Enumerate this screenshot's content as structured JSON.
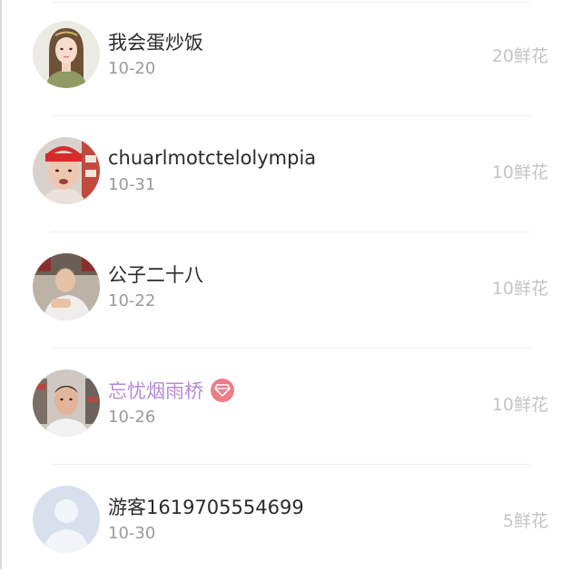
{
  "donors": [
    {
      "name": "我会蛋炒饭",
      "date": "10-20",
      "flowers": "20鲜花",
      "vip": false,
      "avatar_icon": "girl-illustration-avatar"
    },
    {
      "name": "chuarlmotctelolympia",
      "date": "10-31",
      "flowers": "10鲜花",
      "vip": false,
      "avatar_icon": "red-headband-portrait-avatar"
    },
    {
      "name": "公子二十八",
      "date": "10-22",
      "flowers": "10鲜花",
      "vip": false,
      "avatar_icon": "man-sitting-photo-avatar"
    },
    {
      "name": "忘忧烟雨桥",
      "date": "10-26",
      "flowers": "10鲜花",
      "vip": true,
      "avatar_icon": "man-shop-photo-avatar"
    },
    {
      "name": "游客1619705554699",
      "date": "10-30",
      "flowers": "5鲜花",
      "vip": false,
      "avatar_icon": "default-guest-avatar"
    }
  ],
  "colors": {
    "name": "#2a2a2a",
    "vip_name": "#b48ad6",
    "vip_badge": "#ef7b86",
    "date": "#9a9a9a",
    "flowers": "#c4c4c4"
  },
  "icons": {
    "vip_badge": "diamond-icon"
  }
}
